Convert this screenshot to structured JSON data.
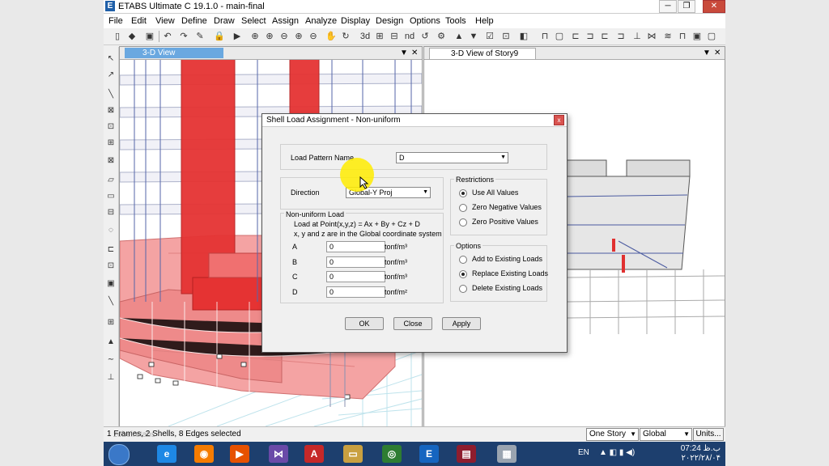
{
  "window": {
    "title": "ETABS Ultimate C 19.1.0 - main-final",
    "logo": "E",
    "min": "─",
    "max": "❐",
    "close": "✕"
  },
  "menu": [
    "File",
    "Edit",
    "View",
    "Define",
    "Draw",
    "Select",
    "Assign",
    "Analyze",
    "Display",
    "Design",
    "Options",
    "Tools",
    "Help"
  ],
  "panes": {
    "left": {
      "title": "3-D View",
      "dropdown": "▼",
      "close": "✕"
    },
    "right": {
      "title": "3-D View of Story9",
      "dropdown": "▼",
      "close": "✕"
    }
  },
  "dialog": {
    "title": "Shell Load Assignment -  Non-uniform",
    "close": "x",
    "load_pattern_label": "Load Pattern Name",
    "load_pattern_value": "D",
    "direction_label": "Direction",
    "direction_value": "Global-Y Proj",
    "nonuniform": {
      "group_label": "Non-uniform Load",
      "formula": "Load at Point(x,y,z) = Ax + By + Cz + D",
      "note": "x, y and z are in the Global coordinate system",
      "rows": [
        {
          "label": "A",
          "value": "0",
          "unit": "tonf/m³"
        },
        {
          "label": "B",
          "value": "0",
          "unit": "tonf/m³"
        },
        {
          "label": "C",
          "value": "0",
          "unit": "tonf/m³"
        },
        {
          "label": "D",
          "value": "0",
          "unit": "tonf/m²"
        }
      ]
    },
    "restrictions": {
      "group_label": "Restrictions",
      "options": [
        "Use All Values",
        "Zero Negative Values",
        "Zero Positive Values"
      ],
      "selected": 0
    },
    "options": {
      "group_label": "Options",
      "items": [
        "Add to Existing Loads",
        "Replace Existing Loads",
        "Delete Existing Loads"
      ],
      "selected": 1
    },
    "buttons": {
      "ok": "OK",
      "close": "Close",
      "apply": "Apply"
    }
  },
  "status": {
    "text": "1 Frames, 2 Shells, 8 Edges selected",
    "story": "One Story",
    "coord": "Global",
    "units": "Units..."
  },
  "watermark": "zobeiretabs",
  "taskbar": {
    "lang": "EN",
    "time": "07:24 ب.ظ",
    "date": "۲۰۲۲/۲۸/۰۴"
  }
}
